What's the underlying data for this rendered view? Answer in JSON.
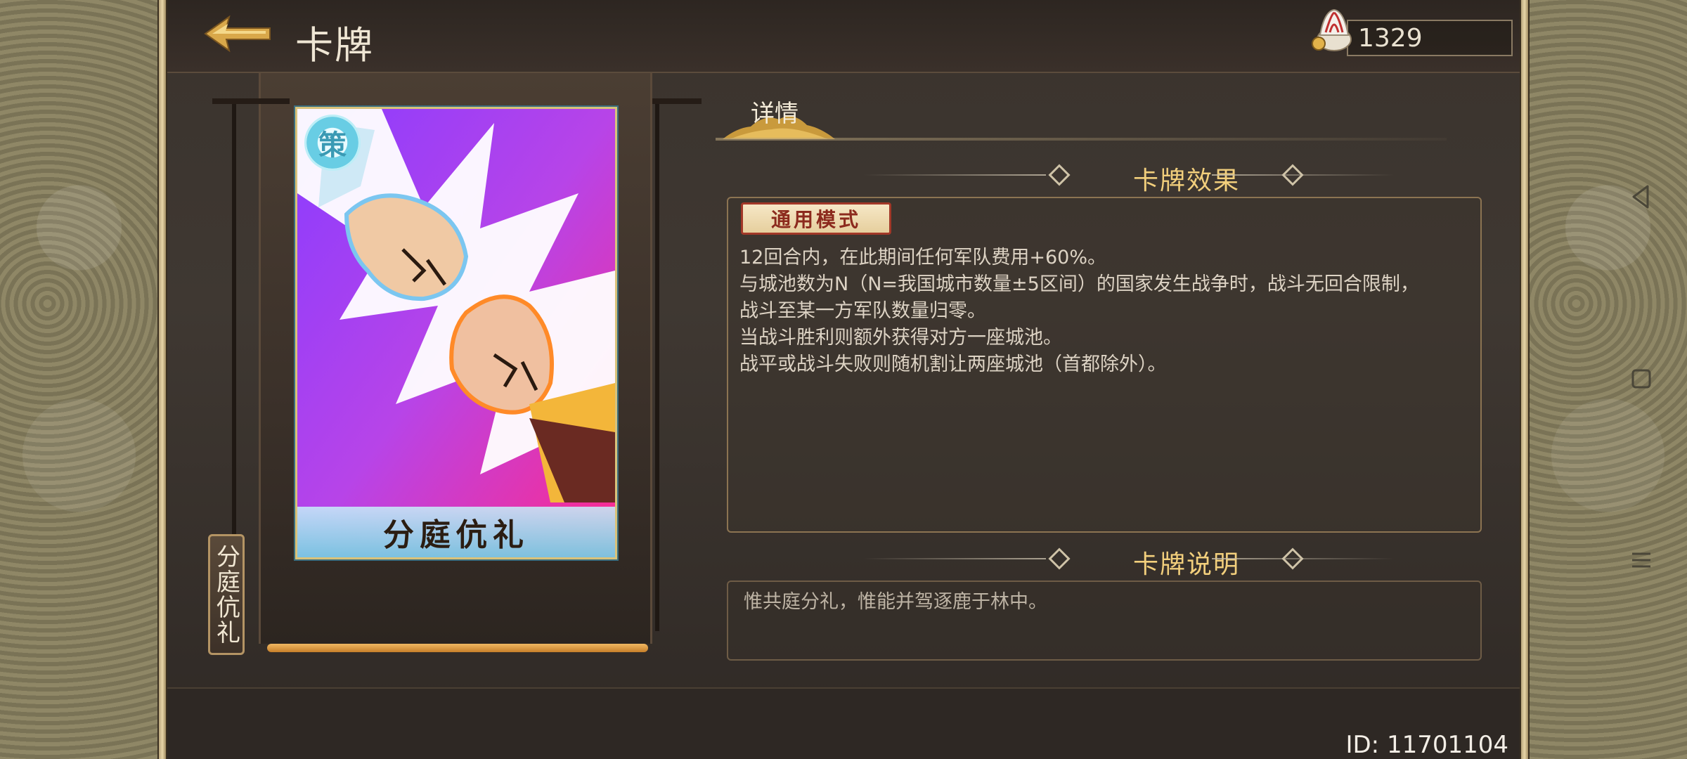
{
  "header": {
    "title": "卡牌",
    "currency_value": "1329"
  },
  "card": {
    "badge_char": "策",
    "name": "分庭伉礼",
    "vertical_label": "分庭伉礼"
  },
  "details": {
    "tab_label": "详情",
    "effect_title": "卡牌效果",
    "mode_tag": "通用模式",
    "effect_lines": [
      "12回合内，在此期间任何军队费用+60%。",
      "与城池数为N（N=我国城市数量±5区间）的国家发生战争时，战斗无回合限制，",
      "战斗至某一方军队数量归零。",
      "当战斗胜利则额外获得对方一座城池。",
      "战平或战斗失败则随机割让两座城池（首都除外）。"
    ],
    "desc_title": "卡牌说明",
    "desc_text": "惟共庭分礼，惟能并驾逐鹿于林中。"
  },
  "footer": {
    "id_text": "ID: 11701104"
  },
  "colors": {
    "accent_gold": "#f2cf7c",
    "mode_tag_red": "#8c2a1d",
    "card_border": "#d9c27a"
  },
  "icons": [
    "back-arrow-icon",
    "feather-helmet-coin-icon",
    "nav-back-icon",
    "nav-home-icon",
    "nav-menu-icon"
  ]
}
